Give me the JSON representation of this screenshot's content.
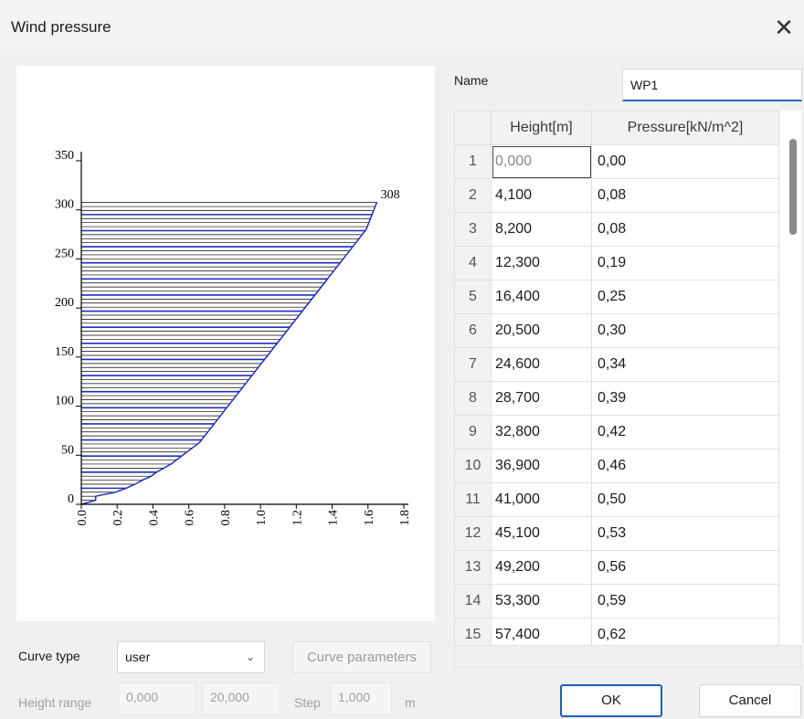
{
  "window": {
    "title": "Wind pressure"
  },
  "chart_data": {
    "type": "area",
    "x": [
      0,
      0.08,
      0.08,
      0.19,
      0.25,
      0.3,
      0.34,
      0.39,
      0.42,
      0.46,
      0.5,
      0.53,
      0.56,
      0.59,
      0.62,
      0.66,
      0.69,
      0.72,
      0.75,
      0.78,
      0.81,
      0.84,
      0.87,
      0.9,
      0.93,
      0.96,
      0.99,
      1.02,
      1.05,
      1.08,
      1.11,
      1.14,
      1.17,
      1.2,
      1.23,
      1.26,
      1.29,
      1.32,
      1.35,
      1.38,
      1.41,
      1.44,
      1.47,
      1.5,
      1.53,
      1.56,
      1.59,
      1.62,
      1.65
    ],
    "y": [
      0,
      4.1,
      8.2,
      12.3,
      16.4,
      20.5,
      24.6,
      28.7,
      32.8,
      36.9,
      41.0,
      45.1,
      49.2,
      53.3,
      57.4,
      63,
      70,
      77,
      84,
      91,
      98,
      105,
      112,
      119,
      126,
      133,
      140,
      147,
      154,
      161,
      168,
      175,
      182,
      189,
      196,
      203,
      210,
      217,
      224,
      231,
      238,
      245,
      252,
      259,
      266,
      273,
      280,
      294,
      308
    ],
    "xlim": [
      0,
      1.8
    ],
    "ylim": [
      0,
      350
    ],
    "x_ticks": [
      "0.0",
      "0.2",
      "0.4",
      "0.6",
      "0.8",
      "1.0",
      "1.2",
      "1.4",
      "1.6",
      "1.8"
    ],
    "y_ticks": [
      "0",
      "50",
      "100",
      "150",
      "200",
      "250",
      "300",
      "350"
    ],
    "annotation": "308",
    "colors": {
      "curve": "#1f2fbf",
      "hline": "#1f2fbf",
      "hline_alt": "#000000",
      "axis": "#000000"
    }
  },
  "form": {
    "name_label": "Name",
    "name_value": "WP1",
    "curve_type_label": "Curve type",
    "curve_type_value": "user",
    "curve_parameters_label": "Curve parameters",
    "height_range_label": "Height range",
    "height_from": "0,000",
    "height_to": "20,000",
    "step_label": "Step",
    "step_value": "1,000",
    "unit_m": "m"
  },
  "grid": {
    "col_height": "Height[m]",
    "col_pressure": "Pressure[kN/m^2]",
    "rows": [
      {
        "n": "1",
        "h": "0,000",
        "p": "0,00"
      },
      {
        "n": "2",
        "h": "4,100",
        "p": "0,08"
      },
      {
        "n": "3",
        "h": "8,200",
        "p": "0,08"
      },
      {
        "n": "4",
        "h": "12,300",
        "p": "0,19"
      },
      {
        "n": "5",
        "h": "16,400",
        "p": "0,25"
      },
      {
        "n": "6",
        "h": "20,500",
        "p": "0,30"
      },
      {
        "n": "7",
        "h": "24,600",
        "p": "0,34"
      },
      {
        "n": "8",
        "h": "28,700",
        "p": "0,39"
      },
      {
        "n": "9",
        "h": "32,800",
        "p": "0,42"
      },
      {
        "n": "10",
        "h": "36,900",
        "p": "0,46"
      },
      {
        "n": "11",
        "h": "41,000",
        "p": "0,50"
      },
      {
        "n": "12",
        "h": "45,100",
        "p": "0,53"
      },
      {
        "n": "13",
        "h": "49,200",
        "p": "0,56"
      },
      {
        "n": "14",
        "h": "53,300",
        "p": "0,59"
      },
      {
        "n": "15",
        "h": "57,400",
        "p": "0,62"
      }
    ]
  },
  "buttons": {
    "ok": "OK",
    "cancel": "Cancel"
  }
}
